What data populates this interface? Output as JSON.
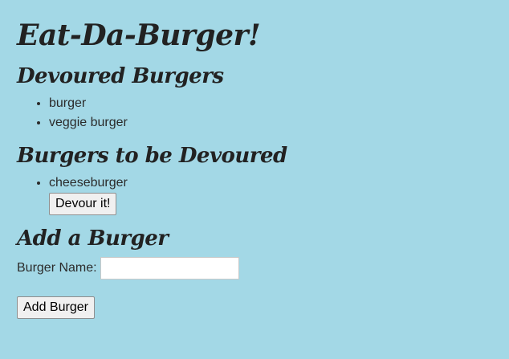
{
  "title": "Eat-Da-Burger!",
  "devoured": {
    "heading": "Devoured Burgers",
    "items": [
      "burger",
      "veggie burger"
    ]
  },
  "to_devour": {
    "heading": "Burgers to be Devoured",
    "items": [
      {
        "name": "cheeseburger",
        "button_label": "Devour it!"
      }
    ]
  },
  "add_form": {
    "heading": "Add a Burger",
    "label": "Burger Name:",
    "input_value": "",
    "button_label": "Add Burger"
  },
  "colors": {
    "background": "#a3d8e6",
    "text": "#2b2b2b"
  }
}
